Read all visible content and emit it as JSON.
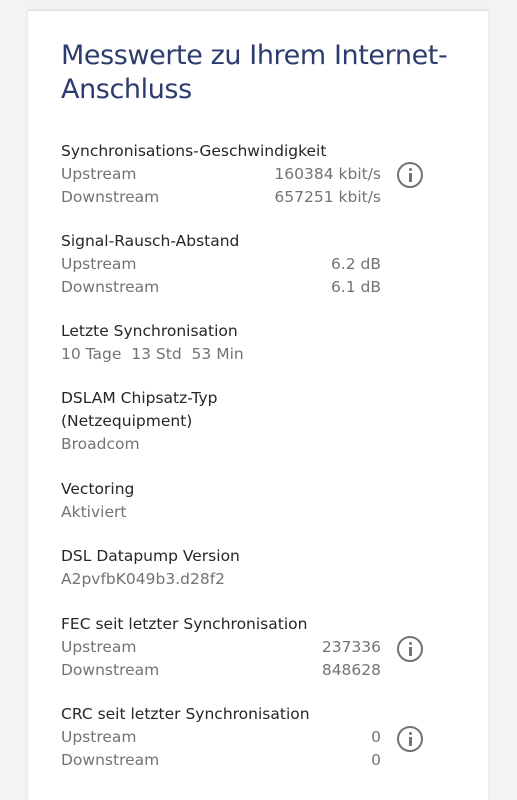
{
  "page": {
    "title": "Messwerte zu Ihrem Internet-Anschluss"
  },
  "sync_speed": {
    "title": "Synchronisations-Geschwindigkeit",
    "upstream_label": "Upstream",
    "upstream_value": "160384 kbit/s",
    "downstream_label": "Downstream",
    "downstream_value": "657251 kbit/s",
    "info_icon": "info-icon"
  },
  "snr": {
    "title": "Signal-Rausch-Abstand",
    "upstream_label": "Upstream",
    "upstream_value": "6.2 dB",
    "downstream_label": "Downstream",
    "downstream_value": "6.1 dB"
  },
  "last_sync": {
    "title": "Letzte Synchronisation",
    "value": "10 Tage  13 Std  53 Min"
  },
  "dslam": {
    "title_line1": "DSLAM Chipsatz-Typ",
    "title_line2": "(Netzequipment)",
    "value": "Broadcom"
  },
  "vectoring": {
    "title": "Vectoring",
    "value": "Aktiviert"
  },
  "datapump": {
    "title": "DSL Datapump Version",
    "value": "A2pvfbK049b3.d28f2"
  },
  "fec": {
    "title": "FEC seit letzter Synchronisation",
    "upstream_label": "Upstream",
    "upstream_value": "237336",
    "downstream_label": "Downstream",
    "downstream_value": "848628",
    "info_icon": "info-icon"
  },
  "crc": {
    "title": "CRC seit letzter Synchronisation",
    "upstream_label": "Upstream",
    "upstream_value": "0",
    "downstream_label": "Downstream",
    "downstream_value": "0",
    "info_icon": "info-icon"
  },
  "colors": {
    "title": "#2d3c6e",
    "text": "#262626",
    "muted": "#737373",
    "card": "#ffffff",
    "background": "#f3f3f4"
  }
}
